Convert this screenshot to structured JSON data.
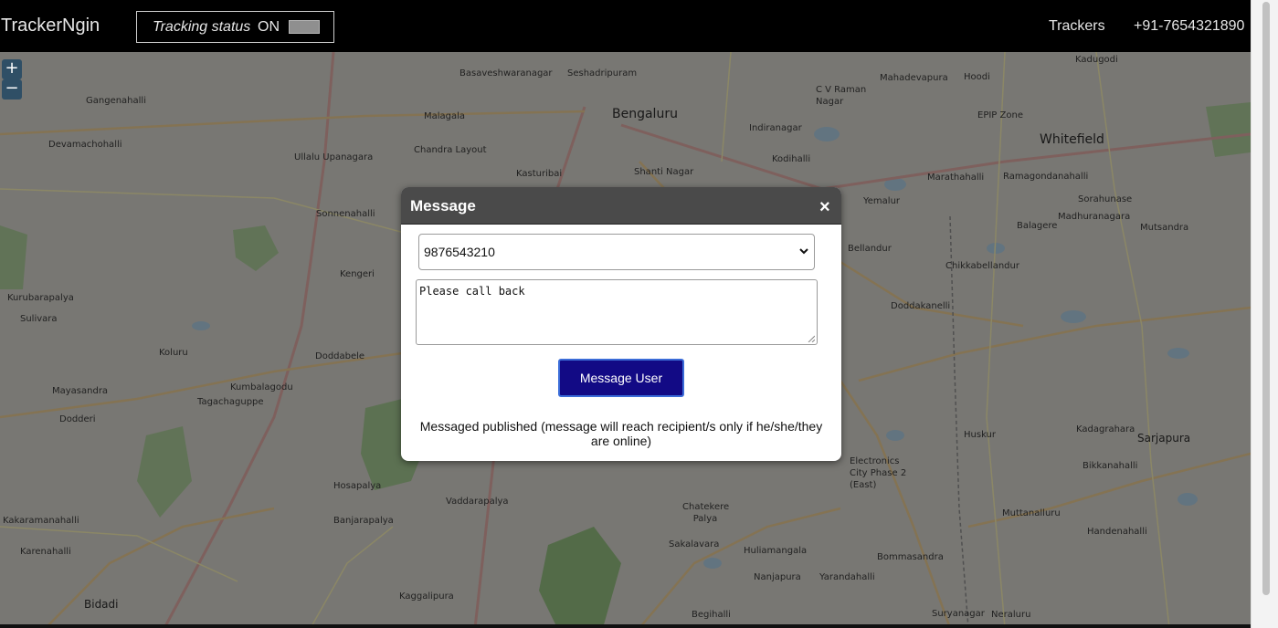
{
  "navbar": {
    "brand": "TrackerNgin",
    "tracking_label": "Tracking status",
    "tracking_state": "ON",
    "links": {
      "trackers": "Trackers",
      "phone": "+91-7654321890"
    }
  },
  "map": {
    "zoom_in": "+",
    "zoom_out": "−",
    "labels": {
      "bengaluru": "Bengaluru",
      "whitefield": "Whitefield",
      "sarjapura": "Sarjapura",
      "bidadi": "Bidadi",
      "epip": "EPIP Zone",
      "electronics": "Electronics City Phase 2 (East)",
      "chandra": "Chandra Layout",
      "kengeri": "Kengeri",
      "jp": "Shanti Nagar",
      "seshadri": "Seshadripuram",
      "basavesh": "Basaveshwaranagar",
      "malagala": "Malagala",
      "vijayanagar": "Kasturibai",
      "ullalu": "Ullalu Upanagara",
      "sonnenahalli": "Sonnenahalli",
      "kumbalagodu": "Kumbalagodu",
      "doddabele": "Doddabele",
      "tagachaguppe": "Tagachaguppe",
      "hosapalya": "Hosapalya",
      "banjarapalya": "Banjarapalya",
      "vaddarapalya": "Vaddarapalya",
      "kaggalipura": "Kaggalipura",
      "bommasandra": "Bommasandra",
      "huskur": "Huskur",
      "marathahalli": "Marathahalli",
      "kadugodi": "Kadugodi",
      "hoodi": "Hoodi",
      "cvraman": "C V Raman Nagar",
      "indiranagar": "Indiranagar",
      "kodihalli": "Kodihalli",
      "yemalur": "Yemalur",
      "bellandur": "Bellandur",
      "doddakanelli": "Doddakanelli",
      "chikkabellandur": "Chikkabellandur",
      "mahadevapura": "Mahadevapura",
      "yarandahalli": "Yarandahalli",
      "chandapura": "Suryanagar",
      "devamachohalli": "Devamachohalli",
      "gangenahalli": "Gangenahalli",
      "sulivara": "Sulivara",
      "mayasandra": "Mayasandra",
      "dodderi": "Dodderi",
      "kolur": "Koluru",
      "kalenahalli": "Karenahalli",
      "kakaramanahalli": "Kakaramanahalli",
      "kurubarapalya": "Kurubarapalya",
      "kadagrahara": "Kadagrahara",
      "varthur": "Ramagondanahalli",
      "sorahunase": "Sorahunase",
      "balagere": "Balagere",
      "mutsandra": "Mutsandra",
      "madhuranagara": "Madhuranagara",
      "bikkanahalli": "Bikkanahalli",
      "muttanallur": "Muttanalluru",
      "hebbagodi": "Handenahalli",
      "neralur": "Neraluru",
      "begihalli": "Begihalli",
      "nanjapura": "Nanjapura",
      "huliamangala": "Huliamangala",
      "sakalavara": "Sakalavara",
      "chatekere": "Chatekere Palya"
    }
  },
  "modal": {
    "title": "Message",
    "close": "×",
    "recipient": "9876543210",
    "message": "Please call back",
    "send_label": "Message User",
    "status": "Messaged published (message will reach recipient/s only if he/she/they are online)"
  }
}
